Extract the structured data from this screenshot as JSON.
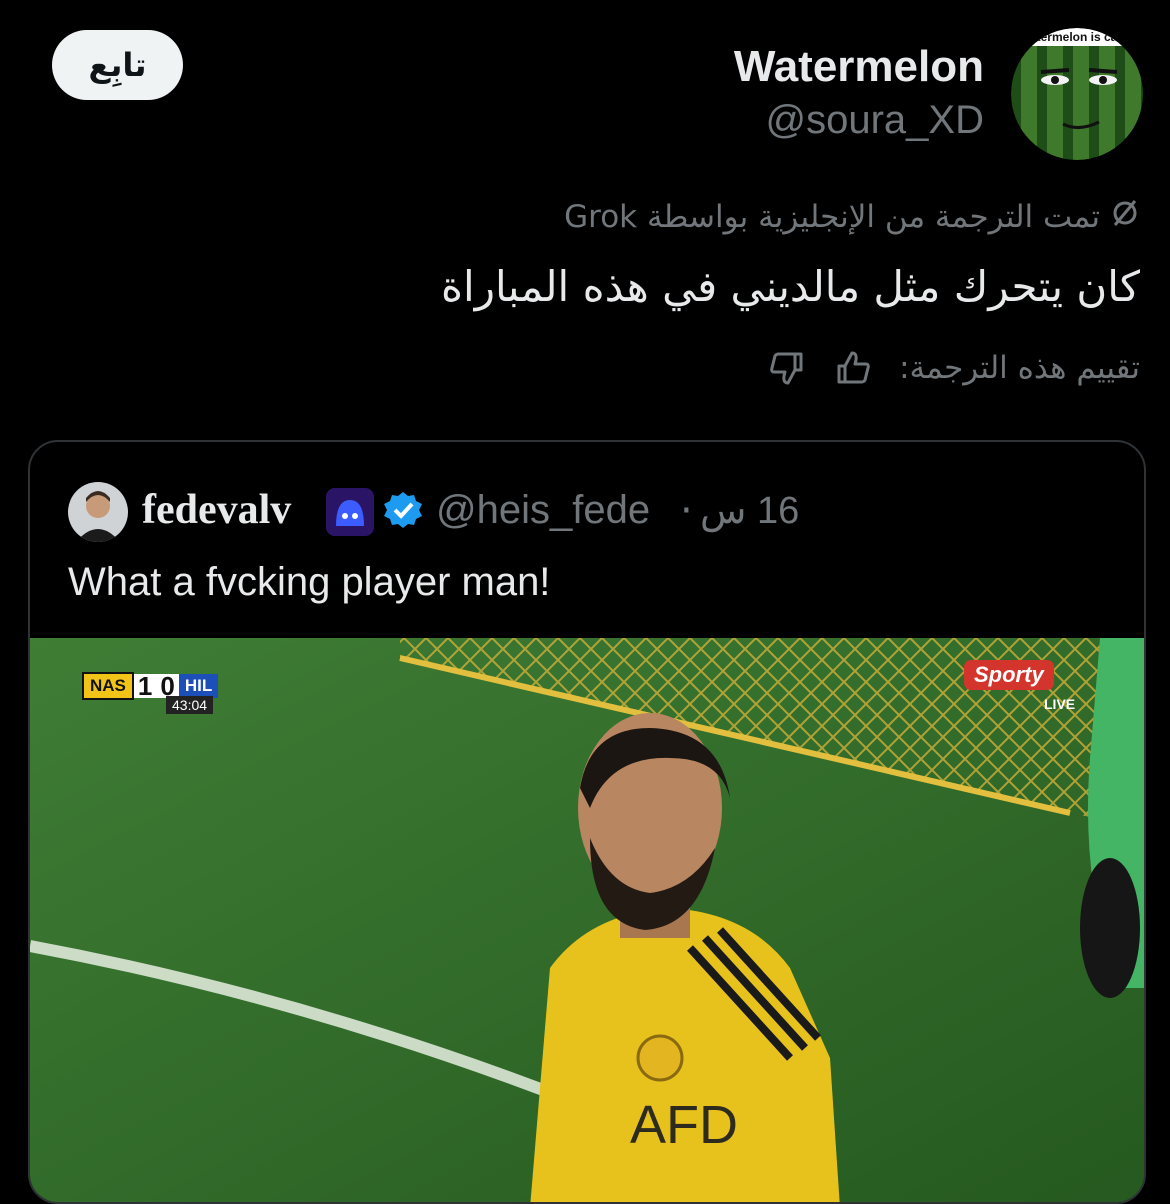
{
  "author": {
    "name": "Watermelon",
    "handle": "@soura_XD",
    "avatar_caption": "termelon is ca",
    "follow_label": "تابِع"
  },
  "translation": {
    "note": "تمت الترجمة من الإنجليزية بواسطة Grok",
    "text": "كان يتحرك مثل مالديني في هذه المباراة",
    "rate_label": "تقييم هذه الترجمة:"
  },
  "quoted_tweet": {
    "name": "fedevalv",
    "handle": "@heis_fede",
    "separator": "·",
    "time": "16 س",
    "text": "What a fvcking player man!",
    "media": {
      "home_team": "NAS",
      "home_score": "1",
      "away_score": "0",
      "away_team": "HIL",
      "clock": "43:04",
      "broadcaster": "Sporty",
      "live_label": "LIVE",
      "shirt_text": "AFD"
    }
  },
  "colors": {
    "background": "#000000",
    "primary_text": "#e7e9ea",
    "secondary_text": "#71767b",
    "border": "#2f3336",
    "verified": "#1d9bf0",
    "jersey": "#e8c21c"
  }
}
